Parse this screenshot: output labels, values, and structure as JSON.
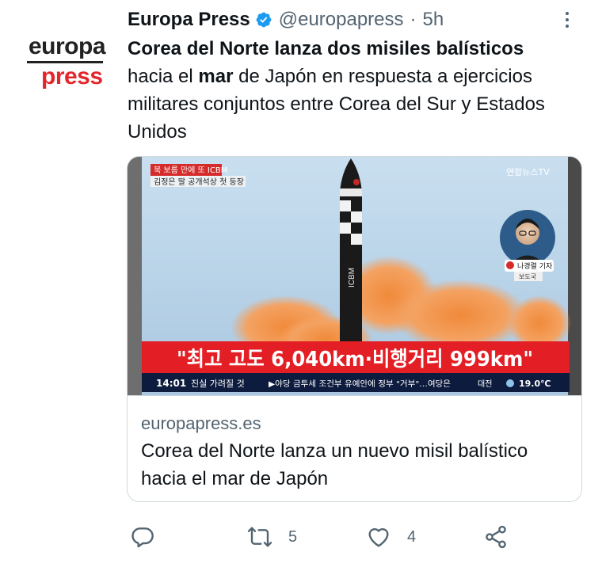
{
  "account": {
    "avatar_line1": "europa",
    "avatar_line2": "press",
    "name": "Europa Press",
    "handle": "@europapress",
    "separator": "·",
    "time": "5h"
  },
  "tweet": {
    "bold_lead": "Corea del Norte lanza dos misiles balísticos",
    "text_part1": "hacia el ",
    "bold_word": "mar",
    "text_part2": " de Japón en respuesta a ejercicios militares conjuntos entre Corea del Sur y Estados Unidos"
  },
  "card": {
    "image": {
      "badge_text": "북 보름 만에 또 ICBM",
      "sub_caption": "김정은 딸 공개석상 첫 등장",
      "channel": "연합뉴스TV",
      "missile_text": "ICBM",
      "reporter_name": "나경렬 기자",
      "reporter_dept": "보도국",
      "headline": "\"최고 고도 6,040km·비행거리 999km\"",
      "clock": "14:01",
      "ticker_label": "진실 가려질 것",
      "ticker_text": "▶야당 금투세 조건부 유예안에 정부 \"거부\"…여당은",
      "weather_city": "대전",
      "weather_temp": "19.0℃"
    },
    "domain": "europapress.es",
    "title": "Corea del Norte lanza un nuevo misil balístico hacia el mar de Japón"
  },
  "actions": {
    "reply_count": "",
    "retweet_count": "5",
    "like_count": "4"
  },
  "colors": {
    "brand_red": "#e3262b",
    "verified_blue": "#1d9bf0",
    "muted": "#536471"
  }
}
